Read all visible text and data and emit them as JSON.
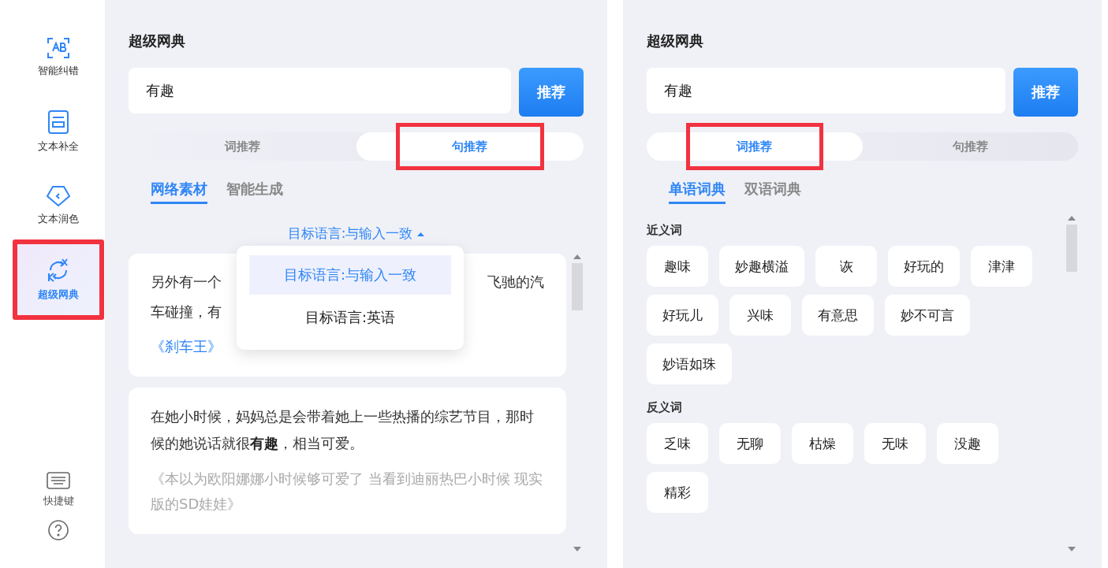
{
  "sidebar": {
    "items": [
      {
        "kind": "correct",
        "label": "智能纠错",
        "selected": false,
        "highlighted": false
      },
      {
        "kind": "complete",
        "label": "文本补全",
        "selected": false,
        "highlighted": false
      },
      {
        "kind": "polish",
        "label": "文本润色",
        "selected": false,
        "highlighted": false
      },
      {
        "kind": "dictionary",
        "label": "超级网典",
        "selected": true,
        "highlighted": true
      }
    ],
    "footer": [
      {
        "kind": "keyboard",
        "label": "快捷键"
      },
      {
        "kind": "help"
      }
    ]
  },
  "panels": [
    {
      "title": "超级网典",
      "query": "有趣",
      "button": "推荐",
      "modes": [
        {
          "label": "词推荐",
          "selected": false,
          "highlighted": false
        },
        {
          "label": "句推荐",
          "selected": true,
          "highlighted": true
        }
      ],
      "subtabs": [
        {
          "label": "网络素材",
          "selected": true
        },
        {
          "label": "智能生成",
          "selected": false
        }
      ],
      "language": {
        "label": "目标语言:与输入一致",
        "expanded": true,
        "options": [
          {
            "label": "目标语言:与输入一致",
            "selected": true
          },
          {
            "label": "目标语言:英语",
            "selected": false
          }
        ]
      },
      "cards": [
        {
          "lines": [
            [
              "另外有一个",
              "飞驰的汽"
            ],
            [
              "车碰撞，有"
            ]
          ],
          "source": "《刹车王》",
          "link": true
        },
        {
          "lines": [
            [
              "在她小时候，妈妈总是会带着她上一些热播的综艺节目，那时候的她说话就很**有趣**，相当可爱。"
            ]
          ],
          "source": "《本以为欧阳娜娜小时候够可爱了 当看到迪丽热巴小时候 现实版的SD娃娃》",
          "link": false
        }
      ]
    },
    {
      "title": "超级网典",
      "query": "有趣",
      "button": "推荐",
      "modes": [
        {
          "label": "词推荐",
          "selected": true,
          "highlighted": true
        },
        {
          "label": "句推荐",
          "selected": false,
          "highlighted": false
        }
      ],
      "subtabs": [
        {
          "label": "单语词典",
          "selected": true
        },
        {
          "label": "双语词典",
          "selected": false
        }
      ],
      "groups": [
        {
          "heading": "近义词",
          "words": [
            "趣味",
            "妙趣横溢",
            "诙",
            "好玩的",
            "津津",
            "好玩儿",
            "兴味",
            "有意思",
            "妙不可言",
            "妙语如珠"
          ]
        },
        {
          "heading": "反义词",
          "words": [
            "乏味",
            "无聊",
            "枯燥",
            "无味",
            "没趣",
            "精彩"
          ]
        }
      ]
    }
  ]
}
